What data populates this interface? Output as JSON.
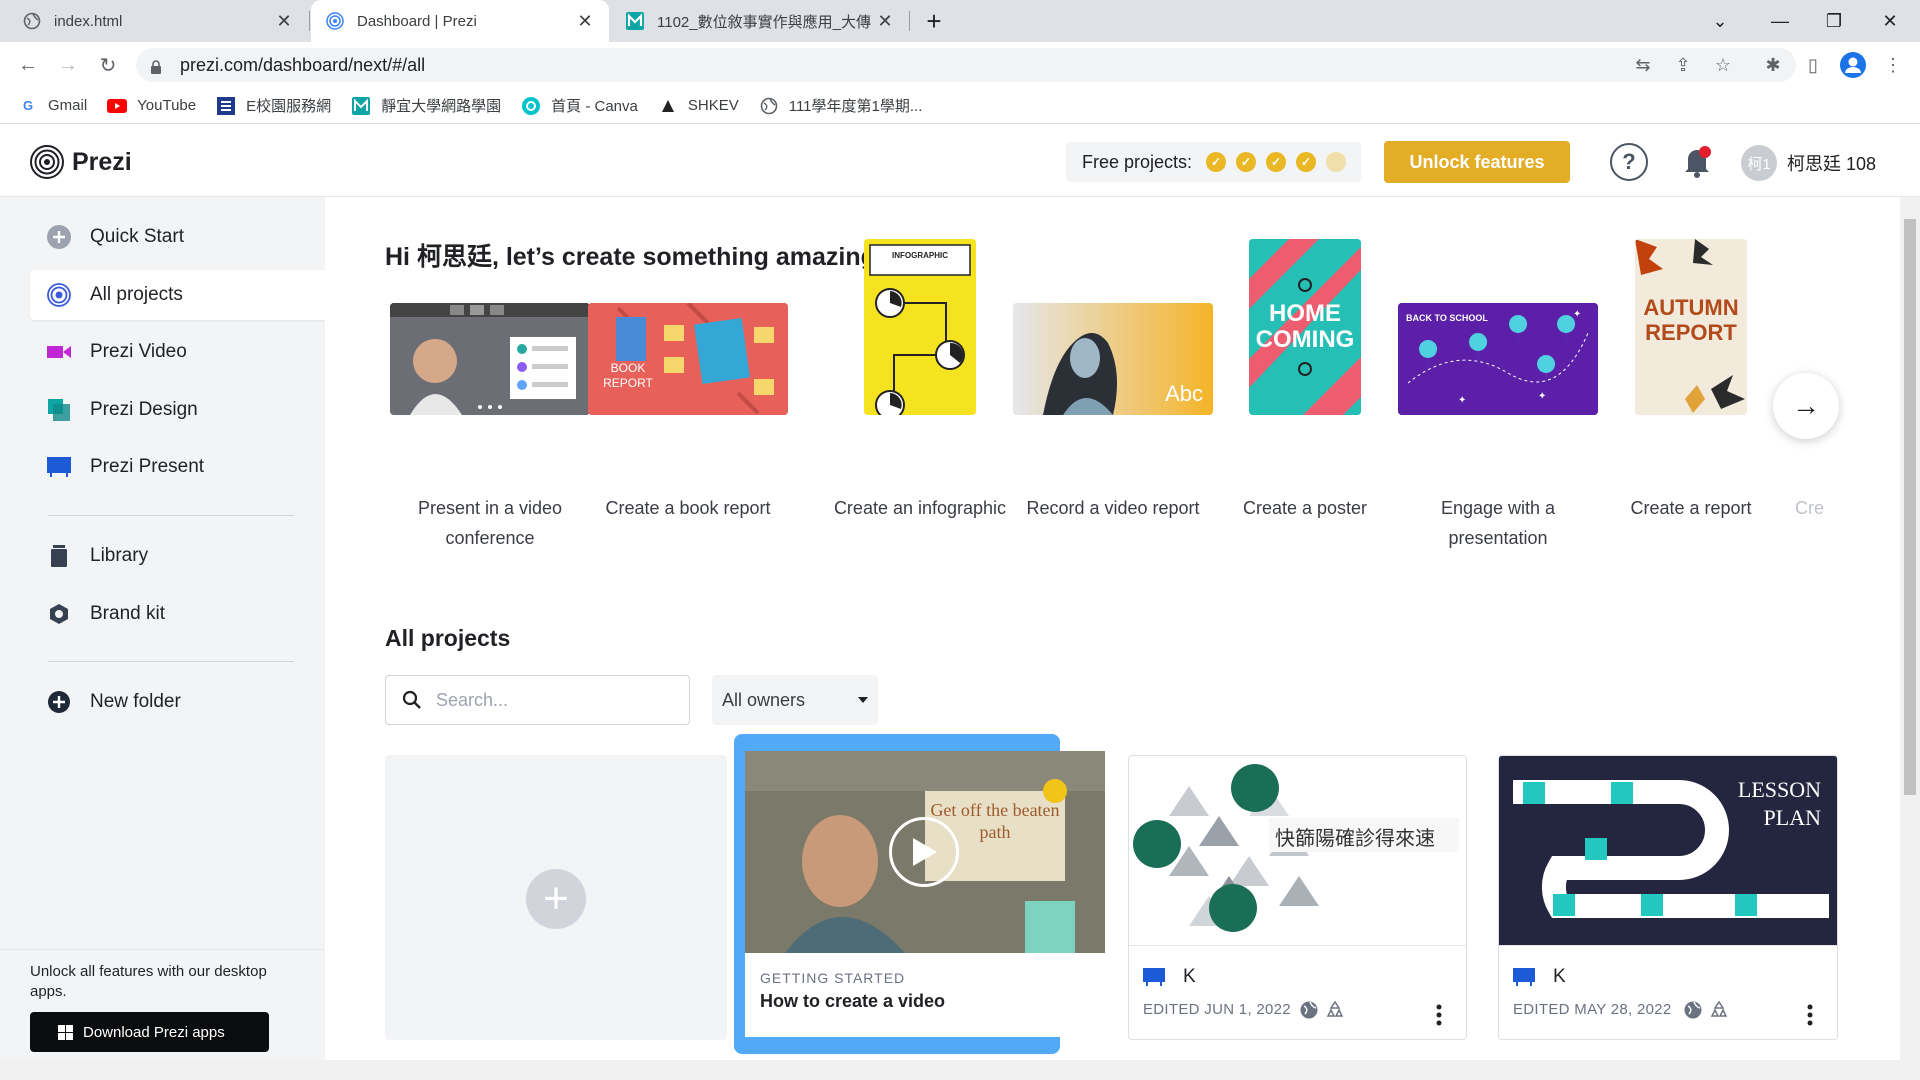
{
  "browser": {
    "tabs": [
      {
        "title": "index.html"
      },
      {
        "title": "Dashboard | Prezi"
      },
      {
        "title": "1102_數位敘事實作與應用_大傳"
      }
    ],
    "url": "prezi.com/dashboard/next/#/all",
    "bookmarks": [
      {
        "label": "Gmail",
        "icon": "google-icon"
      },
      {
        "label": "YouTube",
        "icon": "youtube-icon"
      },
      {
        "label": "E校園服務網",
        "icon": "e-campus-icon"
      },
      {
        "label": "靜宜大學網路學園",
        "icon": "m-icon"
      },
      {
        "label": "首頁 - Canva",
        "icon": "canva-icon"
      },
      {
        "label": "SHKEV",
        "icon": "shkev-icon"
      },
      {
        "label": "111學年度第1學期...",
        "icon": "globe-icon"
      }
    ]
  },
  "header": {
    "logo_text": "Prezi",
    "free_projects_label": "Free projects:",
    "free_projects_used": 4,
    "free_projects_total": 5,
    "unlock_label": "Unlock features",
    "help_label": "?",
    "avatar_text": "柯1",
    "user_name": "柯思廷 108"
  },
  "sidebar": {
    "items": [
      {
        "label": "Quick Start",
        "icon": "plus-circle-icon"
      },
      {
        "label": "All projects",
        "icon": "prezi-spiral-icon"
      },
      {
        "label": "Prezi Video",
        "icon": "video-camera-icon"
      },
      {
        "label": "Prezi Design",
        "icon": "design-icon"
      },
      {
        "label": "Prezi Present",
        "icon": "present-icon"
      },
      {
        "label": "Library",
        "icon": "library-icon"
      },
      {
        "label": "Brand kit",
        "icon": "brand-kit-icon"
      },
      {
        "label": "New folder",
        "icon": "plus-circle-icon"
      }
    ],
    "footer_text": "Unlock all features with our desktop apps.",
    "download_label": "Download Prezi apps"
  },
  "main": {
    "greeting": "Hi 柯思廷, let’s create something amazing today!",
    "templates": [
      {
        "caption": "Present in a video conference"
      },
      {
        "caption": "Create a book report",
        "thumb_text": "BOOK REPORT"
      },
      {
        "caption": "Create an infographic",
        "thumb_text": "INFOGRAPHIC"
      },
      {
        "caption": "Record a video report",
        "thumb_text": "Abc"
      },
      {
        "caption": "Create a poster",
        "thumb_text": "HOME COMING"
      },
      {
        "caption": "Engage with a presentation",
        "thumb_text": "BACK TO SCHOOL"
      },
      {
        "caption": "Create a report",
        "thumb_text": "AUTUMN REPORT"
      },
      {
        "caption": "Cre"
      }
    ],
    "all_projects_title": "All projects",
    "search_placeholder": "Search...",
    "owners_selected": "All owners",
    "video_card": {
      "category": "GETTING STARTED",
      "title": "How to create a video",
      "thumb_text": "Get off the beaten path"
    },
    "projects": [
      {
        "name": "K",
        "edited": "EDITED JUN 1, 2022",
        "thumb_text": "快篩陽確診得來速"
      },
      {
        "name": "K",
        "edited": "EDITED MAY 28, 2022",
        "thumb_text": "LESSON PLAN"
      }
    ]
  },
  "colors": {
    "accent": "#e3ad26",
    "video_card_border": "#52a9f6",
    "sidebar_bg": "#f3f4f6"
  }
}
